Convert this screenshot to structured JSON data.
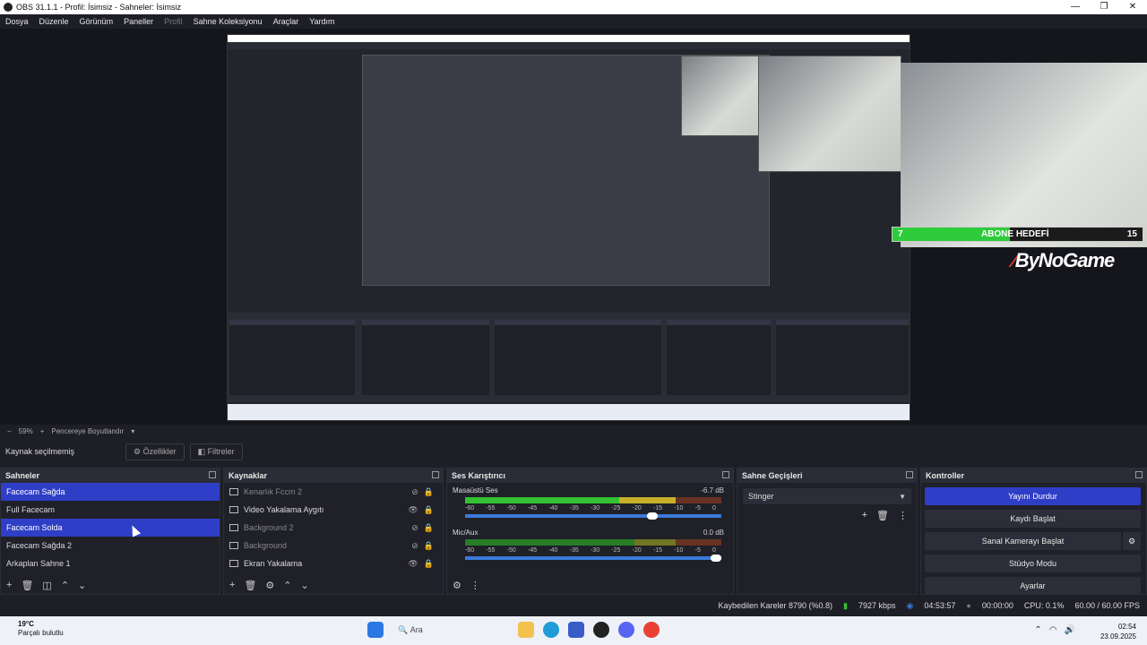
{
  "window": {
    "title": "OBS 31.1.1 - Profil: İsimsiz - Sahneler: İsimsiz",
    "controls": [
      "—",
      "❐",
      "✕"
    ]
  },
  "menu": [
    "Dosya",
    "Düzenle",
    "Görünüm",
    "Paneller",
    "Profil",
    "Sahne Koleksiyonu",
    "Araçlar",
    "Yardım"
  ],
  "overlay": {
    "goal_current": "7",
    "goal_label": "ABONE HEDEFİ",
    "goal_target": "15",
    "goal_fraction": 0.47,
    "brand": "ByNoGame",
    "brand_mark": "⁄"
  },
  "zoom": {
    "minus": "−",
    "value": "59%",
    "plus": "+",
    "resize": "Pencereye Boyutlandır"
  },
  "context": {
    "label": "Kaynak seçilmemiş",
    "properties": "Özellikler",
    "filters": "Filtreler"
  },
  "scenes": {
    "title": "Sahneler",
    "items": [
      {
        "label": "Facecam Sağda",
        "selected": true
      },
      {
        "label": "Full Facecam",
        "selected": false
      },
      {
        "label": "Facecam Solda",
        "selected": true
      },
      {
        "label": "Facecam Sağda 2",
        "selected": false
      },
      {
        "label": "Arkaplan Sahne 1",
        "selected": false
      }
    ]
  },
  "sources": {
    "title": "Kaynaklar",
    "items": [
      {
        "label": "Kenarlık Fccm 2",
        "visible": false
      },
      {
        "label": "Video Yakalama Aygıtı",
        "visible": true
      },
      {
        "label": "Background 2",
        "visible": false
      },
      {
        "label": "Background",
        "visible": false
      },
      {
        "label": "Ekran Yakalama",
        "visible": true
      }
    ]
  },
  "mixer": {
    "title": "Ses Karıştırıcı",
    "channels": [
      {
        "name": "Masaüstü Ses",
        "db": "-6.7 dB",
        "volume": 0.75
      },
      {
        "name": "Mic/Aux",
        "db": "0.0 dB",
        "volume": 1.0
      }
    ],
    "ticks": [
      "-60",
      "-55",
      "-50",
      "-45",
      "-40",
      "-35",
      "-30",
      "-25",
      "-20",
      "-15",
      "-10",
      "-5",
      "0"
    ]
  },
  "transitions": {
    "title": "Sahne Geçişleri",
    "selected": "Stinger"
  },
  "controls": {
    "title": "Kontroller",
    "buttons": [
      "Yayını Durdur",
      "Kaydı Başlat",
      "Sanal Kamerayı Başlat",
      "Stüdyo Modu",
      "Ayarlar"
    ]
  },
  "status": {
    "dropped": "Kaybedilen Kareler 8790 (%0.8)",
    "bitrate": "7927 kbps",
    "stream_time": "04:53:57",
    "rec_time": "00:00:00",
    "cpu": "CPU: 0.1%",
    "fps": "60.00 / 60.00 FPS"
  },
  "taskbar": {
    "weather_temp": "19°C",
    "weather_desc": "Parçalı bulutlu",
    "search": "Ara",
    "time": "02:54",
    "date": "23.09.2025"
  },
  "colors": {
    "accent": "#2f3ec6",
    "goal_green": "#2ecc3b",
    "brand_red": "#e23b2e"
  }
}
